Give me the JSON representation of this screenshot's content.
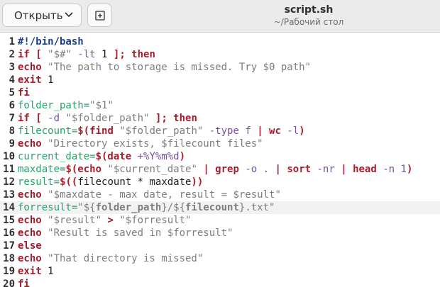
{
  "header": {
    "open_label": "Открыть",
    "title": "script.sh",
    "subtitle": "~/Рабочий стол"
  },
  "colors": {
    "keyword": "#a51d2d",
    "variable": "#26a269",
    "string": "#7d7d7d",
    "option": "#7a4fa0",
    "current_line": "#f2f2f2"
  },
  "editor": {
    "current_line": 14,
    "lines": [
      {
        "n": "1",
        "tokens": [
          [
            "#!/bin/bash",
            "kw-blue"
          ]
        ]
      },
      {
        "n": "2",
        "tokens": [
          [
            "if [ ",
            "kw"
          ],
          [
            "\"$#\"",
            "str"
          ],
          [
            " -lt ",
            "opt"
          ],
          [
            "1",
            "pln"
          ],
          [
            " ]; then",
            "kw"
          ]
        ]
      },
      {
        "n": "3",
        "tokens": [
          [
            "echo",
            "kw"
          ],
          [
            " \"The path to storage is missed. Try $0 path\"",
            "str"
          ]
        ]
      },
      {
        "n": "4",
        "tokens": [
          [
            "exit",
            "kw"
          ],
          [
            " 1",
            "pln"
          ]
        ]
      },
      {
        "n": "5",
        "tokens": [
          [
            "fi",
            "kw"
          ]
        ]
      },
      {
        "n": "6",
        "tokens": [
          [
            "folder_path=",
            "var"
          ],
          [
            "\"$1\"",
            "str"
          ]
        ]
      },
      {
        "n": "7",
        "tokens": [
          [
            "if [ ",
            "kw"
          ],
          [
            "-d ",
            "opt"
          ],
          [
            "\"$folder_path\"",
            "str"
          ],
          [
            " ]; then",
            "kw"
          ]
        ]
      },
      {
        "n": "8",
        "tokens": [
          [
            "filecount=",
            "var"
          ],
          [
            "$(find ",
            "kw"
          ],
          [
            "\"$folder_path\"",
            "str"
          ],
          [
            " -type f ",
            "opt"
          ],
          [
            "| wc ",
            "kw"
          ],
          [
            "-l",
            "opt"
          ],
          [
            ")",
            "kw"
          ]
        ]
      },
      {
        "n": "9",
        "tokens": [
          [
            "echo",
            "kw"
          ],
          [
            " \"Directory exists, $filecount files\"",
            "str"
          ]
        ]
      },
      {
        "n": "10",
        "tokens": [
          [
            "current_date=",
            "var"
          ],
          [
            "$(date ",
            "kw"
          ],
          [
            "+%Y%m%d",
            "opt"
          ],
          [
            ")",
            "kw"
          ]
        ]
      },
      {
        "n": "11",
        "tokens": [
          [
            "maxdate=",
            "var"
          ],
          [
            "$(echo ",
            "kw"
          ],
          [
            "\"$current_date\"",
            "str"
          ],
          [
            " | grep ",
            "kw"
          ],
          [
            "-o . ",
            "opt"
          ],
          [
            "| sort ",
            "kw"
          ],
          [
            "-nr ",
            "opt"
          ],
          [
            "| head ",
            "kw"
          ],
          [
            "-n 1",
            "opt"
          ],
          [
            ")",
            "kw"
          ]
        ]
      },
      {
        "n": "12",
        "tokens": [
          [
            "result=",
            "var"
          ],
          [
            "$((",
            "kw"
          ],
          [
            "filecount * maxdate",
            "pln"
          ],
          [
            "))",
            "kw"
          ]
        ]
      },
      {
        "n": "13",
        "tokens": [
          [
            "echo",
            "kw"
          ],
          [
            " \"$maxdate - max date, result = $result\"",
            "str"
          ]
        ]
      },
      {
        "n": "14",
        "tokens": [
          [
            "forresult=",
            "var"
          ],
          [
            "\"${",
            "str"
          ],
          [
            "folder_path",
            "bld"
          ],
          [
            "}/",
            "str"
          ],
          [
            "${",
            "str"
          ],
          [
            "filecount",
            "bld"
          ],
          [
            "}.txt\"",
            "str"
          ]
        ]
      },
      {
        "n": "15",
        "tokens": [
          [
            "echo",
            "kw"
          ],
          [
            " \"$result\"",
            "str"
          ],
          [
            " > ",
            "kw"
          ],
          [
            "\"$forresult\"",
            "str"
          ]
        ]
      },
      {
        "n": "16",
        "tokens": [
          [
            "echo",
            "kw"
          ],
          [
            " \"Result is saved in $forresult\"",
            "str"
          ]
        ]
      },
      {
        "n": "17",
        "tokens": [
          [
            "else",
            "kw"
          ]
        ]
      },
      {
        "n": "18",
        "tokens": [
          [
            "echo",
            "kw"
          ],
          [
            " \"That directory is missed\"",
            "str"
          ]
        ]
      },
      {
        "n": "19",
        "tokens": [
          [
            "exit",
            "kw"
          ],
          [
            " 1",
            "pln"
          ]
        ]
      },
      {
        "n": "20",
        "tokens": [
          [
            "fi",
            "kw"
          ]
        ]
      }
    ]
  }
}
